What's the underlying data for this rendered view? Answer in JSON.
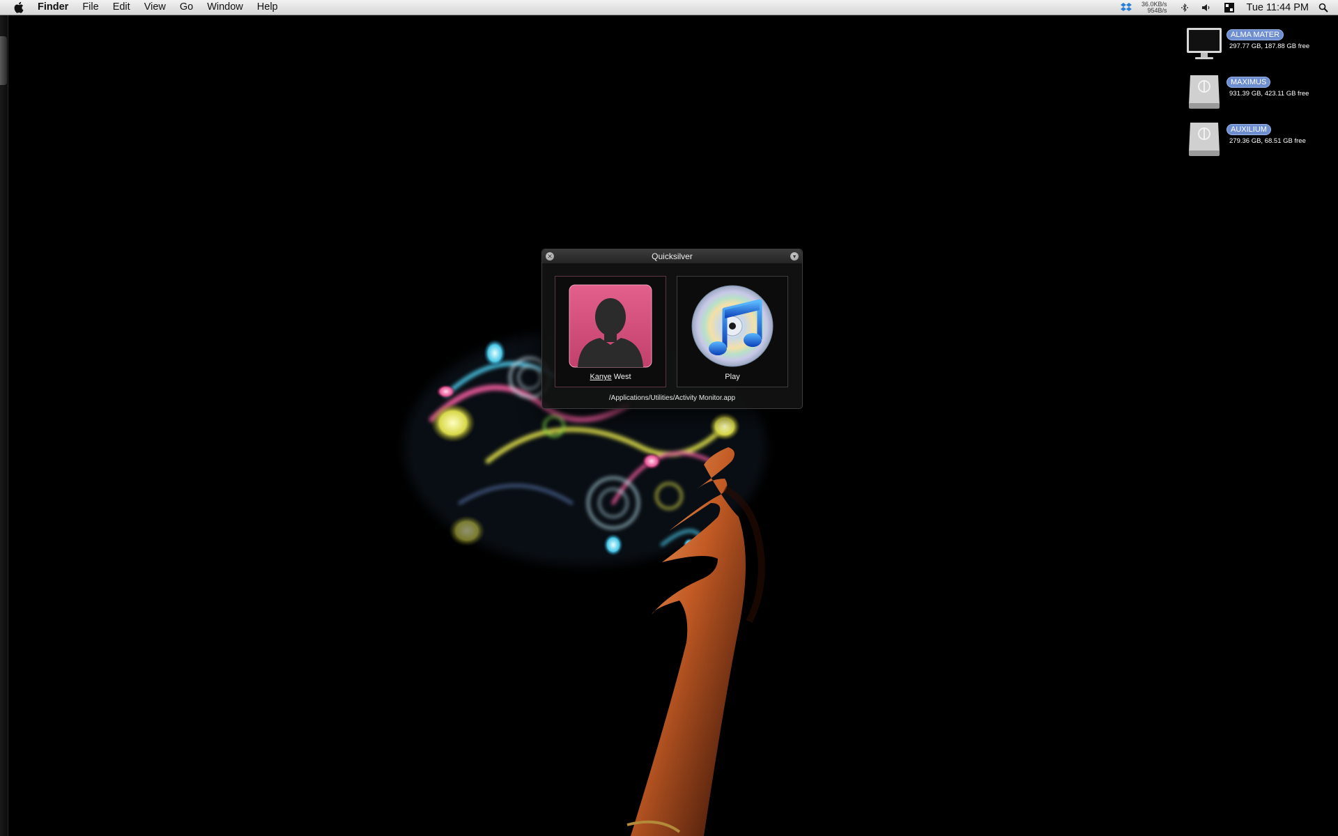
{
  "menubar": {
    "apple_icon": "apple-logo-icon",
    "app_name": "Finder",
    "items": [
      "File",
      "Edit",
      "View",
      "Go",
      "Window",
      "Help"
    ],
    "status": {
      "net_upload": "36.0KB/s",
      "net_download": "954B/s",
      "clock": "Tue 11:44 PM",
      "icons": [
        "dropbox-icon",
        "bluetooth-icon",
        "volume-icon",
        "spaces-icon",
        "spotlight-icon"
      ]
    }
  },
  "desktop": {
    "drives": [
      {
        "name": "ALMA MATER",
        "capacity": "297.77 GB, 187.88 GB free",
        "icon": "monitor-drive-icon"
      },
      {
        "name": "MAXIMUS",
        "capacity": "931.39 GB, 423.11 GB free",
        "icon": "external-drive-icon"
      },
      {
        "name": "AUXILIUM",
        "capacity": "279.36 GB, 68.51 GB free",
        "icon": "external-drive-icon"
      }
    ]
  },
  "quicksilver": {
    "title": "Quicksilver",
    "subject": {
      "label_match": "Kanye",
      "label_rest": " West",
      "icon": "contact-person-icon"
    },
    "action": {
      "label": "Play",
      "icon": "itunes-icon"
    },
    "path": "/Applications/Utilities/Activity Monitor.app"
  },
  "colors": {
    "drive_label_bg": "#6d8ed1",
    "contact_pink": "#d44f7c",
    "itunes_blue": "#1f64d8"
  }
}
